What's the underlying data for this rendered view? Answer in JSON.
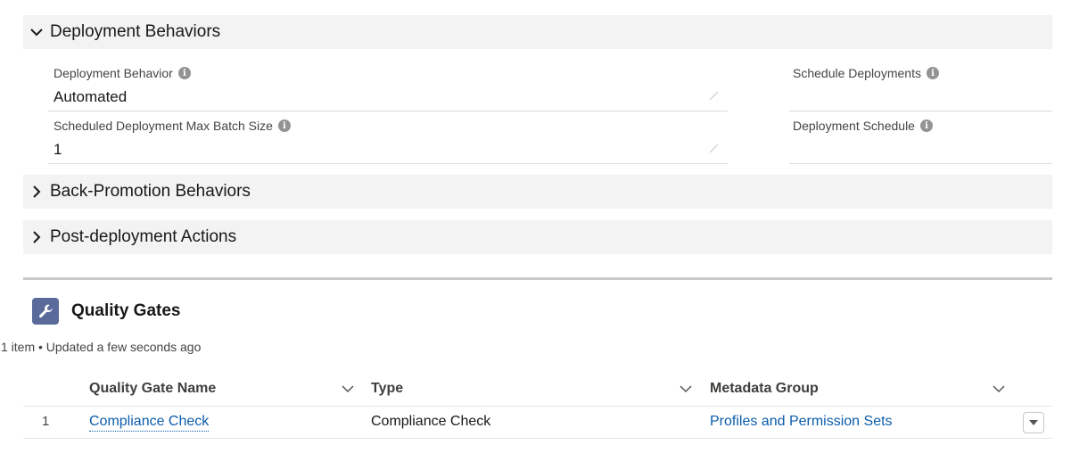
{
  "sections": {
    "deployment": {
      "title": "Deployment Behaviors",
      "expanded": true
    },
    "back_promotion": {
      "title": "Back-Promotion Behaviors",
      "expanded": false
    },
    "post_deployment": {
      "title": "Post-deployment Actions",
      "expanded": false
    }
  },
  "fields": {
    "deployment_behavior": {
      "label": "Deployment Behavior",
      "value": "Automated"
    },
    "schedule_deployments": {
      "label": "Schedule Deployments",
      "value": ""
    },
    "max_batch_size": {
      "label": "Scheduled Deployment Max Batch Size",
      "value": "1"
    },
    "deployment_schedule": {
      "label": "Deployment Schedule",
      "value": ""
    }
  },
  "quality_gates": {
    "title": "Quality Gates",
    "icon": "wrench-icon",
    "meta": "1 item • Updated a few seconds ago",
    "columns": [
      "Quality Gate Name",
      "Type",
      "Metadata Group"
    ],
    "rows": [
      {
        "num": "1",
        "name": "Compliance Check",
        "type": "Compliance Check",
        "metadata_group": "Profiles and Permission Sets"
      }
    ]
  },
  "colors": {
    "header_bg": "#f3f3f3",
    "link": "#0b5cab",
    "icon_bg": "#5a6a9a",
    "info_icon": "#939393"
  }
}
